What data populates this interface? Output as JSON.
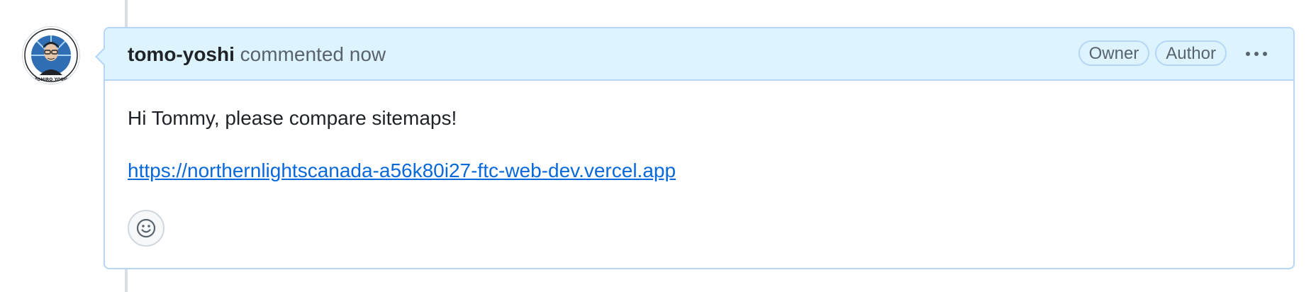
{
  "comment": {
    "author": "tomo-yoshi",
    "action": "commented",
    "time": "now",
    "badges": [
      "Owner",
      "Author"
    ],
    "body_text": "Hi Tommy, please compare sitemaps!",
    "link_text": "https://northernlightscanada-a56k80i27-ftc-web-dev.vercel.app"
  },
  "avatar": {
    "lettering": "TOMOHIRO YOSHIDA"
  },
  "icons": {
    "menu": "kebab-horizontal-icon",
    "reaction": "smiley-icon"
  },
  "colors": {
    "header_bg": "#ddf4ff",
    "border": "#b6d6f5",
    "link": "#0969da",
    "muted": "#59636e"
  }
}
